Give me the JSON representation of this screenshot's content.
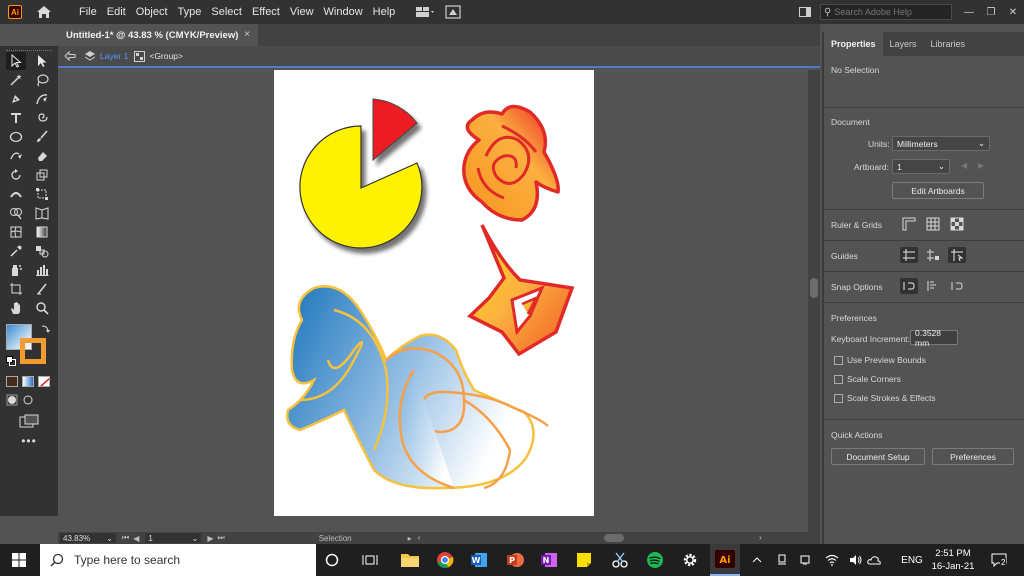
{
  "app": {
    "logo": "Ai",
    "menu": [
      "File",
      "Edit",
      "Object",
      "Type",
      "Select",
      "Effect",
      "View",
      "Window",
      "Help"
    ],
    "search_placeholder": "Search Adobe Help"
  },
  "document": {
    "tab_title": "Untitled-1* @ 43.83 % (CMYK/Preview)",
    "close": "×",
    "breadcrumb_layer": "Layer 1",
    "breadcrumb_group": "<Group>"
  },
  "status": {
    "zoom": "43.83%",
    "artboard": "1",
    "tool": "Selection"
  },
  "panel": {
    "tabs": [
      "Properties",
      "Layers",
      "Libraries"
    ],
    "no_selection": "No Selection",
    "document_heading": "Document",
    "units_label": "Units:",
    "units_value": "Millimeters",
    "artboard_label": "Artboard:",
    "artboard_value": "1",
    "edit_artboards": "Edit Artboards",
    "ruler_grids": "Ruler & Grids",
    "guides": "Guides",
    "snap_options": "Snap Options",
    "preferences_heading": "Preferences",
    "keyboard_increment_label": "Keyboard Increment:",
    "keyboard_increment_value": "0.3528 mm",
    "checkboxes": [
      "Use Preview Bounds",
      "Scale Corners",
      "Scale Strokes & Effects"
    ],
    "quick_actions": "Quick Actions",
    "document_setup": "Document Setup",
    "preferences_button": "Preferences"
  },
  "taskbar": {
    "search_placeholder": "Type here to search",
    "language": "ENG",
    "time": "2:51 PM",
    "date": "16-Jan-21",
    "notifications": "2"
  },
  "colors": {
    "ai_orange": "#ff9a00",
    "accent_blue": "#4e7ad0",
    "pie_yellow": "#fff200",
    "pie_red": "#ed1c24"
  }
}
